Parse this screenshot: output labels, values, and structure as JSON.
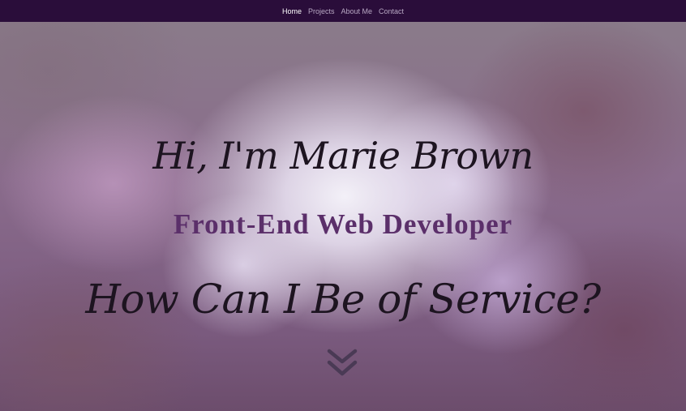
{
  "nav": {
    "items": [
      {
        "label": "Home",
        "active": true
      },
      {
        "label": "Projects",
        "active": false
      },
      {
        "label": "About Me",
        "active": false
      },
      {
        "label": "Contact",
        "active": false
      }
    ]
  },
  "hero": {
    "greeting": "Hi, I'm Marie Brown",
    "subtitle": "Front-End Web Developer",
    "tagline": "How Can I Be of Service?",
    "scroll_icon": "double-chevron-down-icon"
  },
  "colors": {
    "navbar": "#2a0d3a",
    "subtitle": "#5b2f6a",
    "headline": "#1d1420",
    "chevron": "#4a3a55"
  }
}
